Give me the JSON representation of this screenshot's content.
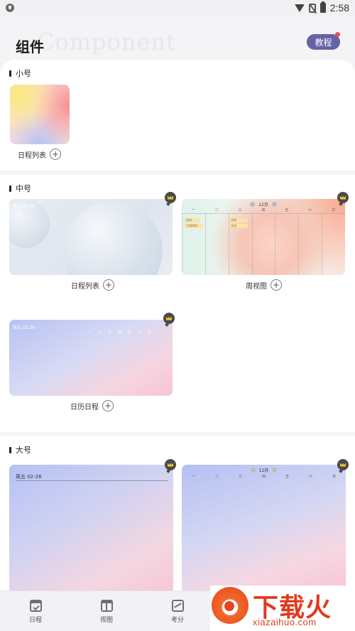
{
  "status_bar": {
    "time": "2:58"
  },
  "header": {
    "title": "组件",
    "title_watermark": "Component",
    "tutorial_label": "教程"
  },
  "sections": {
    "small": {
      "title": "小号",
      "widgets": [
        {
          "label": "日程列表",
          "add": "+"
        }
      ]
    },
    "medium": {
      "title": "中号",
      "widgets": [
        {
          "label": "日程列表",
          "add": "+",
          "preview_date": "周五 02-26"
        },
        {
          "label": "周视图",
          "add": "+",
          "preview_month": "12月",
          "preview_days": [
            "一",
            "二",
            "三",
            "四",
            "五",
            "六",
            "日"
          ],
          "preview_events": [
            "活动",
            "下班时间",
            "活动",
            "活动"
          ]
        },
        {
          "label": "日历日程",
          "add": "+",
          "preview_date": "周五 02-26",
          "preview_days": [
            "一",
            "二",
            "三",
            "四",
            "五",
            "六",
            "日"
          ]
        }
      ]
    },
    "large": {
      "title": "大号",
      "widgets": [
        {
          "preview_date": "周五 02-26"
        },
        {
          "preview_month": "12月",
          "preview_days": [
            "一",
            "二",
            "三",
            "四",
            "五",
            "六",
            "日"
          ]
        }
      ]
    }
  },
  "bottom_nav": [
    {
      "label": "日程",
      "icon": "calendar-check-icon"
    },
    {
      "label": "视图",
      "icon": "view-layout-icon"
    },
    {
      "label": "考分",
      "icon": "trend-chart-icon"
    }
  ],
  "site_logo": {
    "text": "下载火",
    "url": "xiazaihuo.com"
  },
  "colors": {
    "accent": "#6662a6",
    "badge": "#e6534f",
    "logo": "#e23a1c"
  }
}
